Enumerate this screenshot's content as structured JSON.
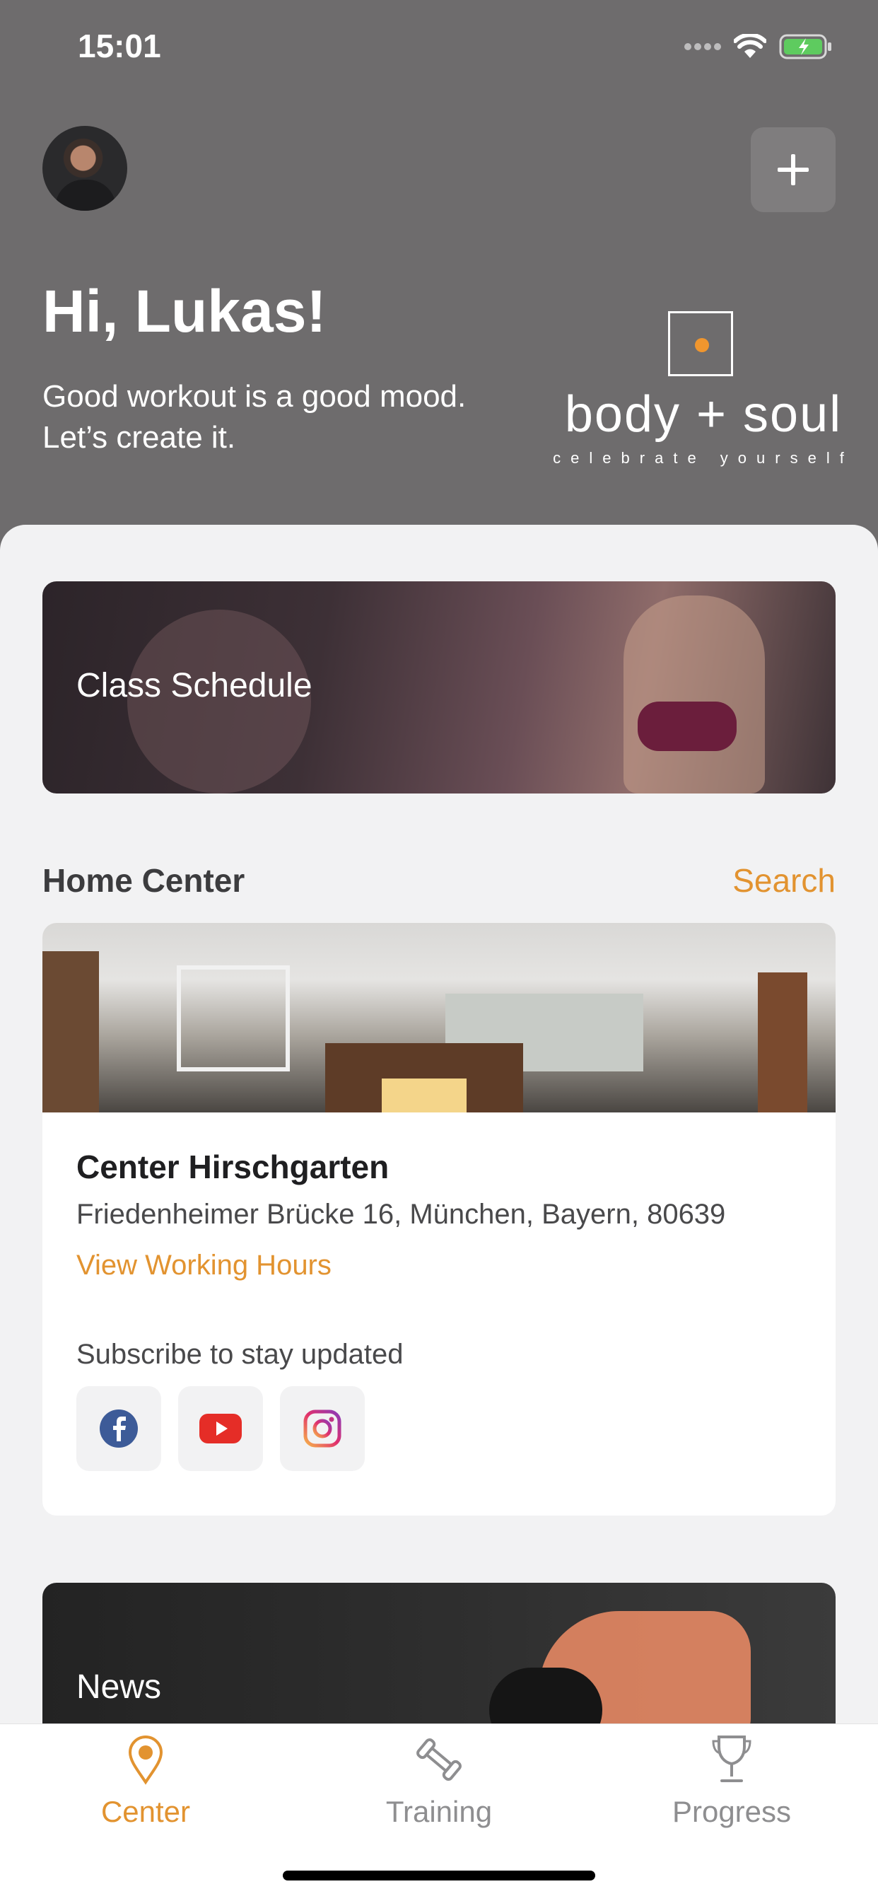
{
  "status_bar": {
    "time": "15:01"
  },
  "header": {
    "greeting": "Hi, Lukas!",
    "tagline_line1": "Good workout is a good mood.",
    "tagline_line2": "Let’s create it.",
    "logo_wordmark": "body + soul",
    "logo_subtitle": "celebrate yourself"
  },
  "class_schedule": {
    "label": "Class Schedule"
  },
  "home_center": {
    "section_title": "Home Center",
    "search_label": "Search",
    "name": "Center Hirschgarten",
    "address": "Friedenheimer Brücke 16, München, Bayern, 80639",
    "hours_link": "View Working Hours",
    "subscribe_label": "Subscribe to stay updated",
    "social": [
      "facebook-icon",
      "youtube-icon",
      "instagram-icon"
    ]
  },
  "news": {
    "label": "News"
  },
  "tab_bar": {
    "items": [
      {
        "label": "Center",
        "icon": "location-pin-icon",
        "active": true
      },
      {
        "label": "Training",
        "icon": "dumbbell-icon",
        "active": false
      },
      {
        "label": "Progress",
        "icon": "trophy-icon",
        "active": false
      }
    ]
  },
  "colors": {
    "accent": "#e29330",
    "header_bg": "#6e6c6d",
    "brand_dot": "#f0962e"
  }
}
